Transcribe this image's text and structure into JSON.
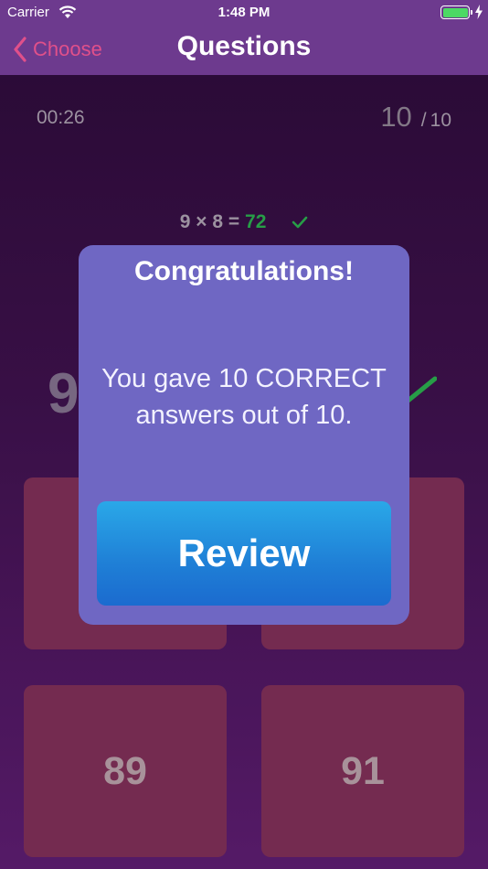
{
  "status_bar": {
    "carrier": "Carrier",
    "time": "1:48 PM"
  },
  "nav": {
    "back_label": "Choose",
    "title": "Questions"
  },
  "game": {
    "timer": "00:26",
    "progress_current": "10",
    "progress_separator": "/",
    "progress_total": "10",
    "last_question_text": "9 × 8 = ",
    "last_question_answer": "72",
    "big_question_partial": "9",
    "answers": [
      "",
      "",
      "89",
      "91"
    ]
  },
  "dialog": {
    "title": "Congratulations!",
    "message_line1": "You gave 10 CORRECT",
    "message_line2": "answers out of 10.",
    "review_label": "Review"
  },
  "colors": {
    "nav_bg": "#6d3a8e",
    "accent_pink": "#e0508a",
    "correct_green": "#2aa64b",
    "dialog_bg": "#6f67c3",
    "review_blue": "#1f7fd6",
    "tile_bg": "#7b2e55"
  },
  "icons": [
    "wifi-icon",
    "battery-icon",
    "charging-icon",
    "chevron-left-icon",
    "check-icon"
  ]
}
